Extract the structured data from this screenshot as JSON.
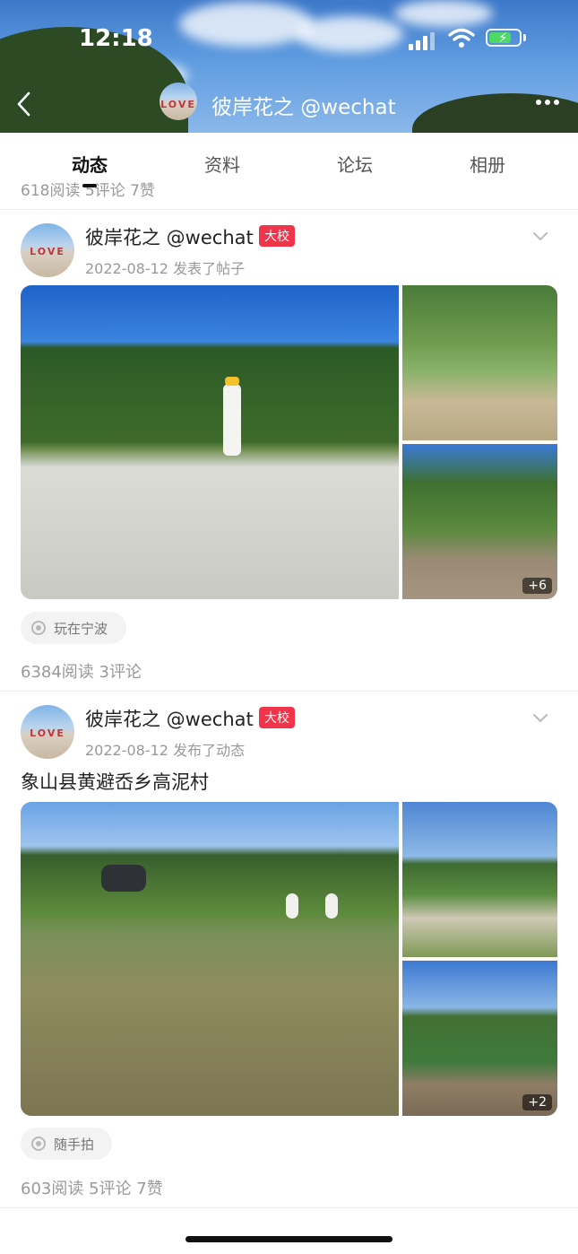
{
  "status_bar": {
    "time": "12:18"
  },
  "header": {
    "title": "彼岸花之 @wechat",
    "avatar_text": "LOVE"
  },
  "tabs": [
    {
      "label": "动态",
      "active": true
    },
    {
      "label": "资料",
      "active": false
    },
    {
      "label": "论坛",
      "active": false
    },
    {
      "label": "相册",
      "active": false
    }
  ],
  "previous_post_stats": "618阅读  5评论  7赞",
  "posts": [
    {
      "author": "彼岸花之 @wechat",
      "badge": "大校",
      "avatar_text": "LOVE",
      "meta": "2022-08-12 发表了帖子",
      "text": "",
      "more_images": "+6",
      "tag": "玩在宁波",
      "stats": "6384阅读  3评论"
    },
    {
      "author": "彼岸花之 @wechat",
      "badge": "大校",
      "avatar_text": "LOVE",
      "meta": "2022-08-12 发布了动态",
      "text": "象山县黄避岙乡高泥村",
      "more_images": "+2",
      "tag": "随手拍",
      "stats": "603阅读  5评论  7赞"
    }
  ],
  "colors": {
    "badge": "#f0354a",
    "accent_text": "#111111",
    "muted_text": "#999999"
  }
}
